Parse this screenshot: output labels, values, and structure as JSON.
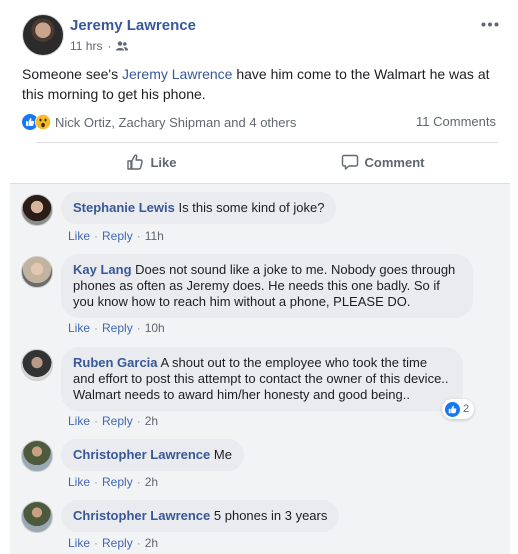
{
  "post": {
    "author": "Jeremy Lawrence",
    "time": "11 hrs",
    "audience_icon": "friends-icon",
    "text_before": "Someone see's ",
    "mention": "Jeremy Lawrence",
    "text_after": " have him come to the Walmart he was at this morning to get his phone.",
    "reaction_names": "Nick Ortiz, Zachary Shipman and 4 others",
    "comment_count": "11 Comments"
  },
  "actions": {
    "like": "Like",
    "comment": "Comment"
  },
  "comments": [
    {
      "author": "Stephanie Lewis",
      "text": "Is this some kind of joke?",
      "like": "Like",
      "reply": "Reply",
      "time": "11h"
    },
    {
      "author": "Kay Lang",
      "text": "Does not sound like a joke to me. Nobody goes through phones as often as Jeremy does. He needs this one badly. So if you know how to reach him without a phone, PLEASE DO.",
      "like": "Like",
      "reply": "Reply",
      "time": "10h"
    },
    {
      "author": "Ruben Garcia",
      "text": "A shout out to the employee who took the time and effort to post this attempt to contact the owner of this device.. Walmart needs to award him/her honesty and good being..",
      "like": "Like",
      "reply": "Reply",
      "time": "2h",
      "likes": "2"
    },
    {
      "author": "Christopher Lawrence",
      "text": "Me",
      "like": "Like",
      "reply": "Reply",
      "time": "2h"
    },
    {
      "author": "Christopher Lawrence",
      "text": "5 phones in 3 years",
      "like": "Like",
      "reply": "Reply",
      "time": "2h"
    }
  ],
  "colors": {
    "link": "#385898",
    "action_link": "#4267b2",
    "like_blue": "#1877f2",
    "wow_yellow": "#f7b928"
  }
}
